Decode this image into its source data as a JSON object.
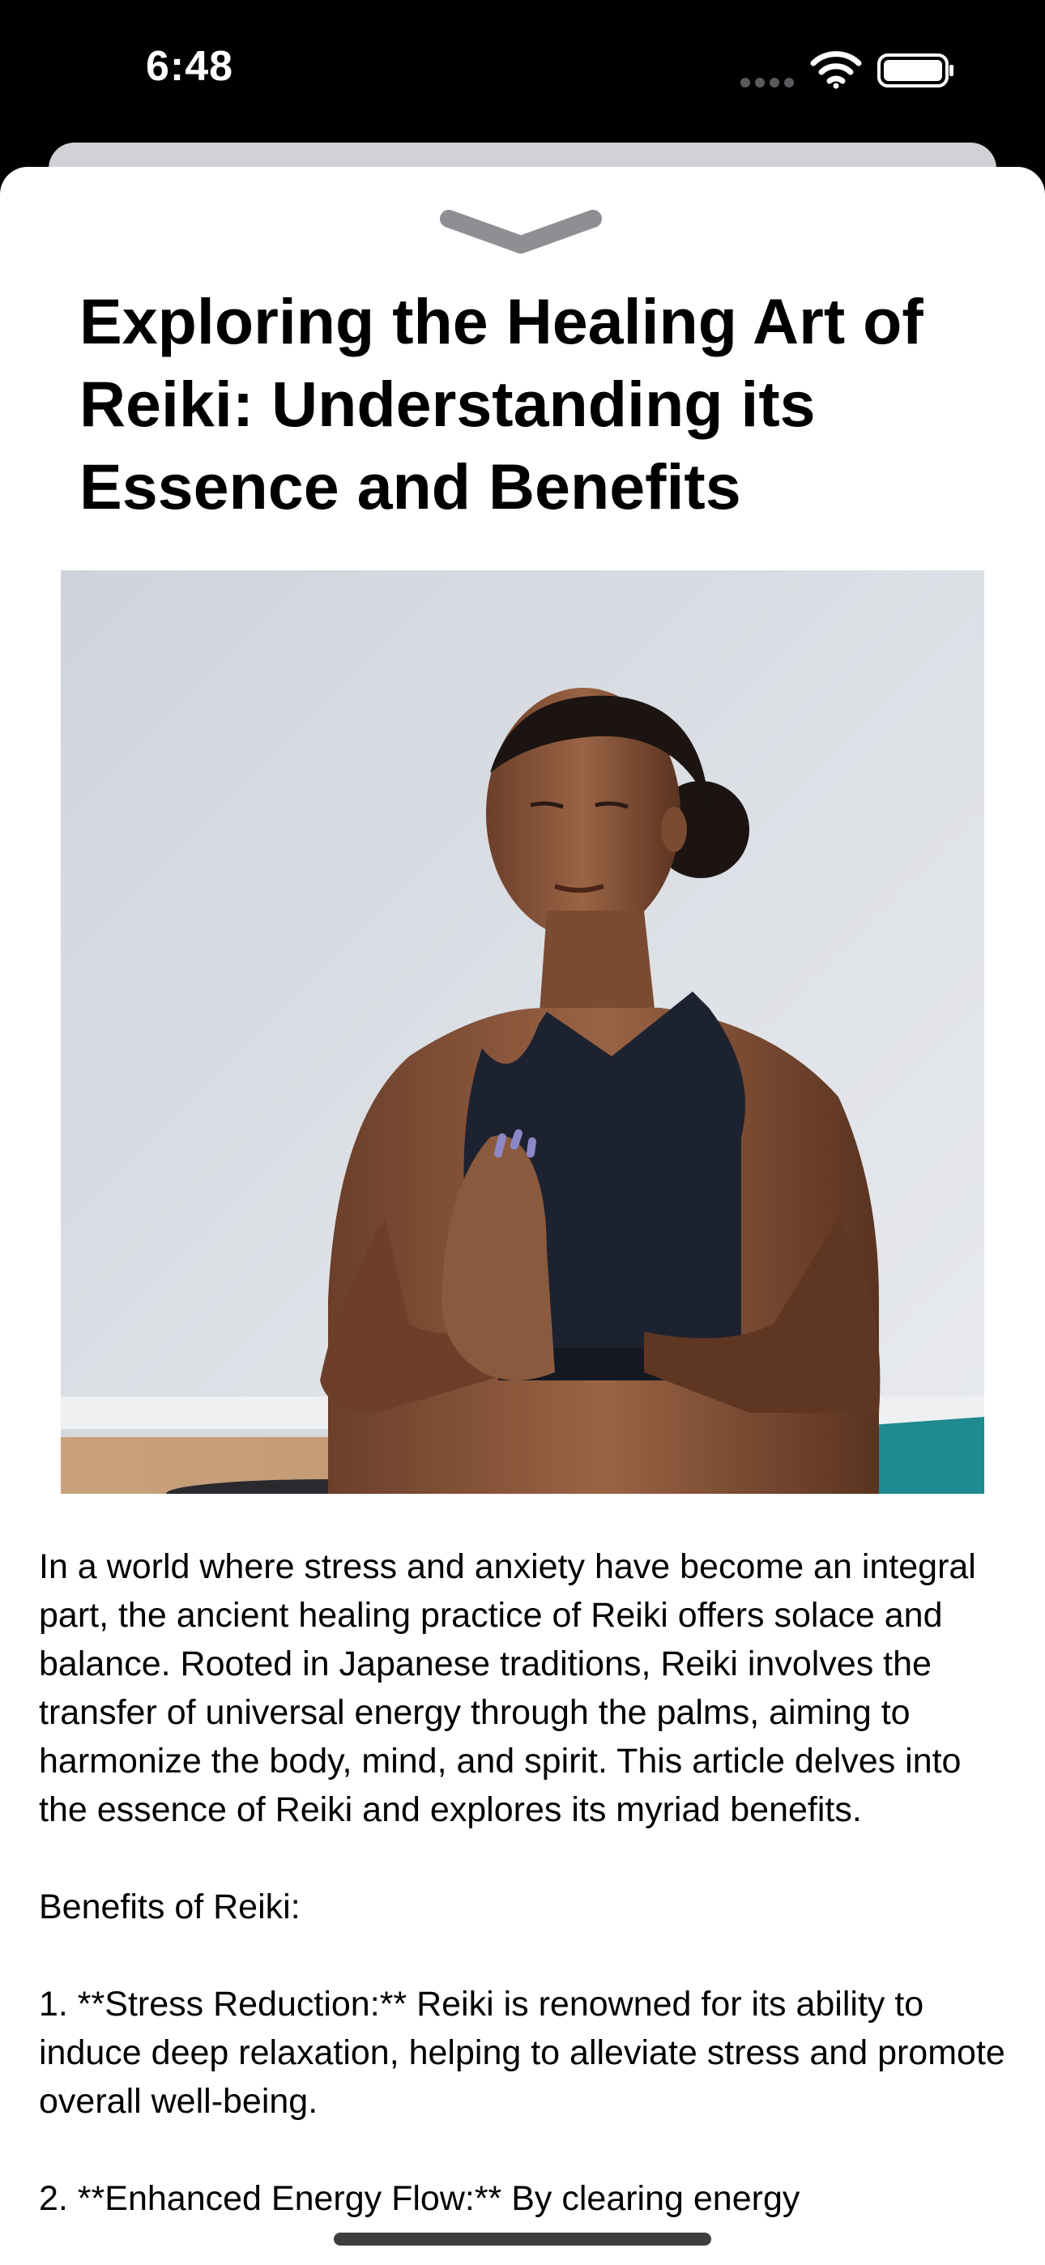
{
  "status_bar": {
    "time": "6:48",
    "icons": [
      "cellular-dots-icon",
      "wifi-icon",
      "battery-icon"
    ]
  },
  "sheet": {
    "dismiss_icon": "chevron-down-icon"
  },
  "article": {
    "title": "Exploring the Healing Art of Reiki: Understanding its Essence and Benefits",
    "image_description_icon": "meditating-woman-image",
    "paragraphs": [
      "In a world where stress and anxiety have become an integral part, the ancient healing practice of Reiki offers solace and balance. Rooted in Japanese traditions, Reiki involves the transfer of universal energy through the palms, aiming to harmonize the body, mind, and spirit. This article delves into the essence of Reiki and explores its myriad benefits.",
      "Benefits of Reiki:",
      "1. **Stress Reduction:** Reiki is renowned for its ability to induce deep relaxation, helping to alleviate stress and promote overall well-being.",
      "2. **Enhanced Energy Flow:** By clearing energy"
    ]
  },
  "colors": {
    "status_bar_bg": "#000000",
    "sheet_bg": "#ffffff",
    "sheet_behind": "#d1d1d6",
    "chevron": "#8e8e93",
    "text": "#000000"
  }
}
